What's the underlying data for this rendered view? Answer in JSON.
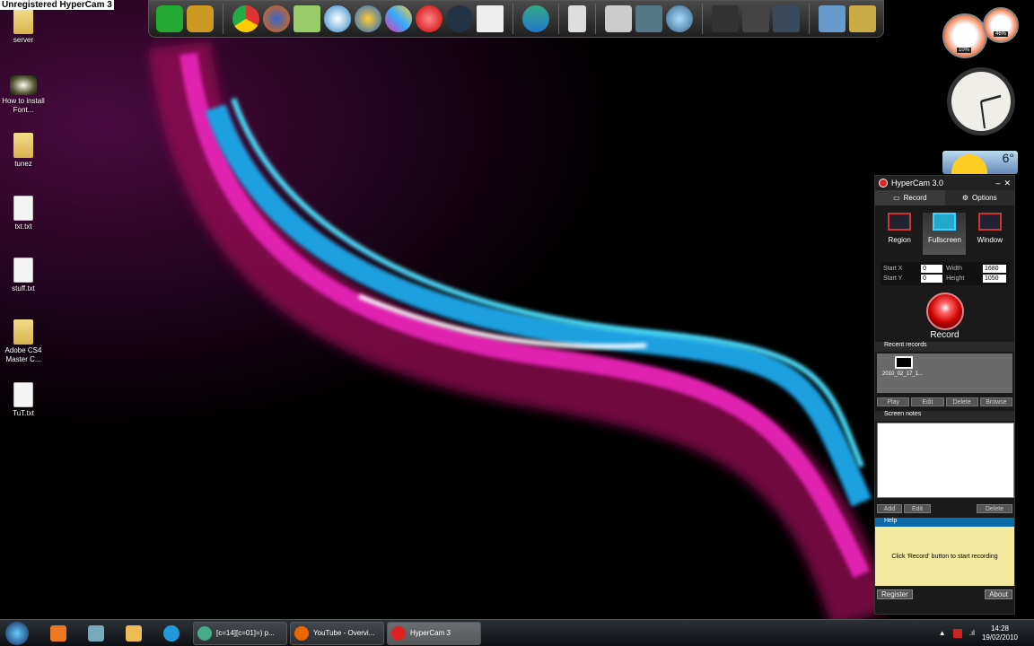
{
  "watermark": "Unregistered HyperCam 3",
  "desktop_icons": [
    {
      "label": "server",
      "type": "folder"
    },
    {
      "label": "How to install Font...",
      "type": "video"
    },
    {
      "label": "tunez",
      "type": "folder"
    },
    {
      "label": "txt.txt",
      "type": "doc"
    },
    {
      "label": "stuff.txt",
      "type": "doc"
    },
    {
      "label": "Adobe CS4 Master C...",
      "type": "folder"
    },
    {
      "label": "TuT.txt",
      "type": "doc"
    }
  ],
  "gadgets": {
    "cpu_percent": "10%",
    "memory_percent": "46%",
    "weather_temp": "6°",
    "clock_time": "14:28"
  },
  "hypercam": {
    "title": "HyperCam 3.0",
    "tabs": [
      "Record",
      "Options"
    ],
    "modes": [
      "Region",
      "Fullscreen",
      "Window"
    ],
    "selected_mode": "Fullscreen",
    "start_x_label": "Start X",
    "start_x": "0",
    "start_y_label": "Start Y",
    "start_y": "0",
    "width_label": "Width",
    "width": "1680",
    "height_label": "Height",
    "height": "1050",
    "record_label": "Record",
    "recent_title": "Recent records",
    "recent_item": "2010_02_17_1...",
    "recent_buttons": [
      "Play",
      "Edit",
      "Delete",
      "Browse"
    ],
    "notes_title": "Screen notes",
    "notes_buttons": [
      "Add",
      "Edit",
      "Delete"
    ],
    "help_title": "Help",
    "help_text": "Click 'Record' button to start recording",
    "register_label": "Register",
    "about_label": "About"
  },
  "taskbar": {
    "windows": [
      {
        "label": "[c=14][c=01]=) p...",
        "color": "#4a8"
      },
      {
        "label": "YouTube - Overvi...",
        "color": "#e60"
      },
      {
        "label": "HyperCam 3",
        "color": "#d22"
      }
    ],
    "time": "14:28",
    "date": "19/02/2010"
  }
}
